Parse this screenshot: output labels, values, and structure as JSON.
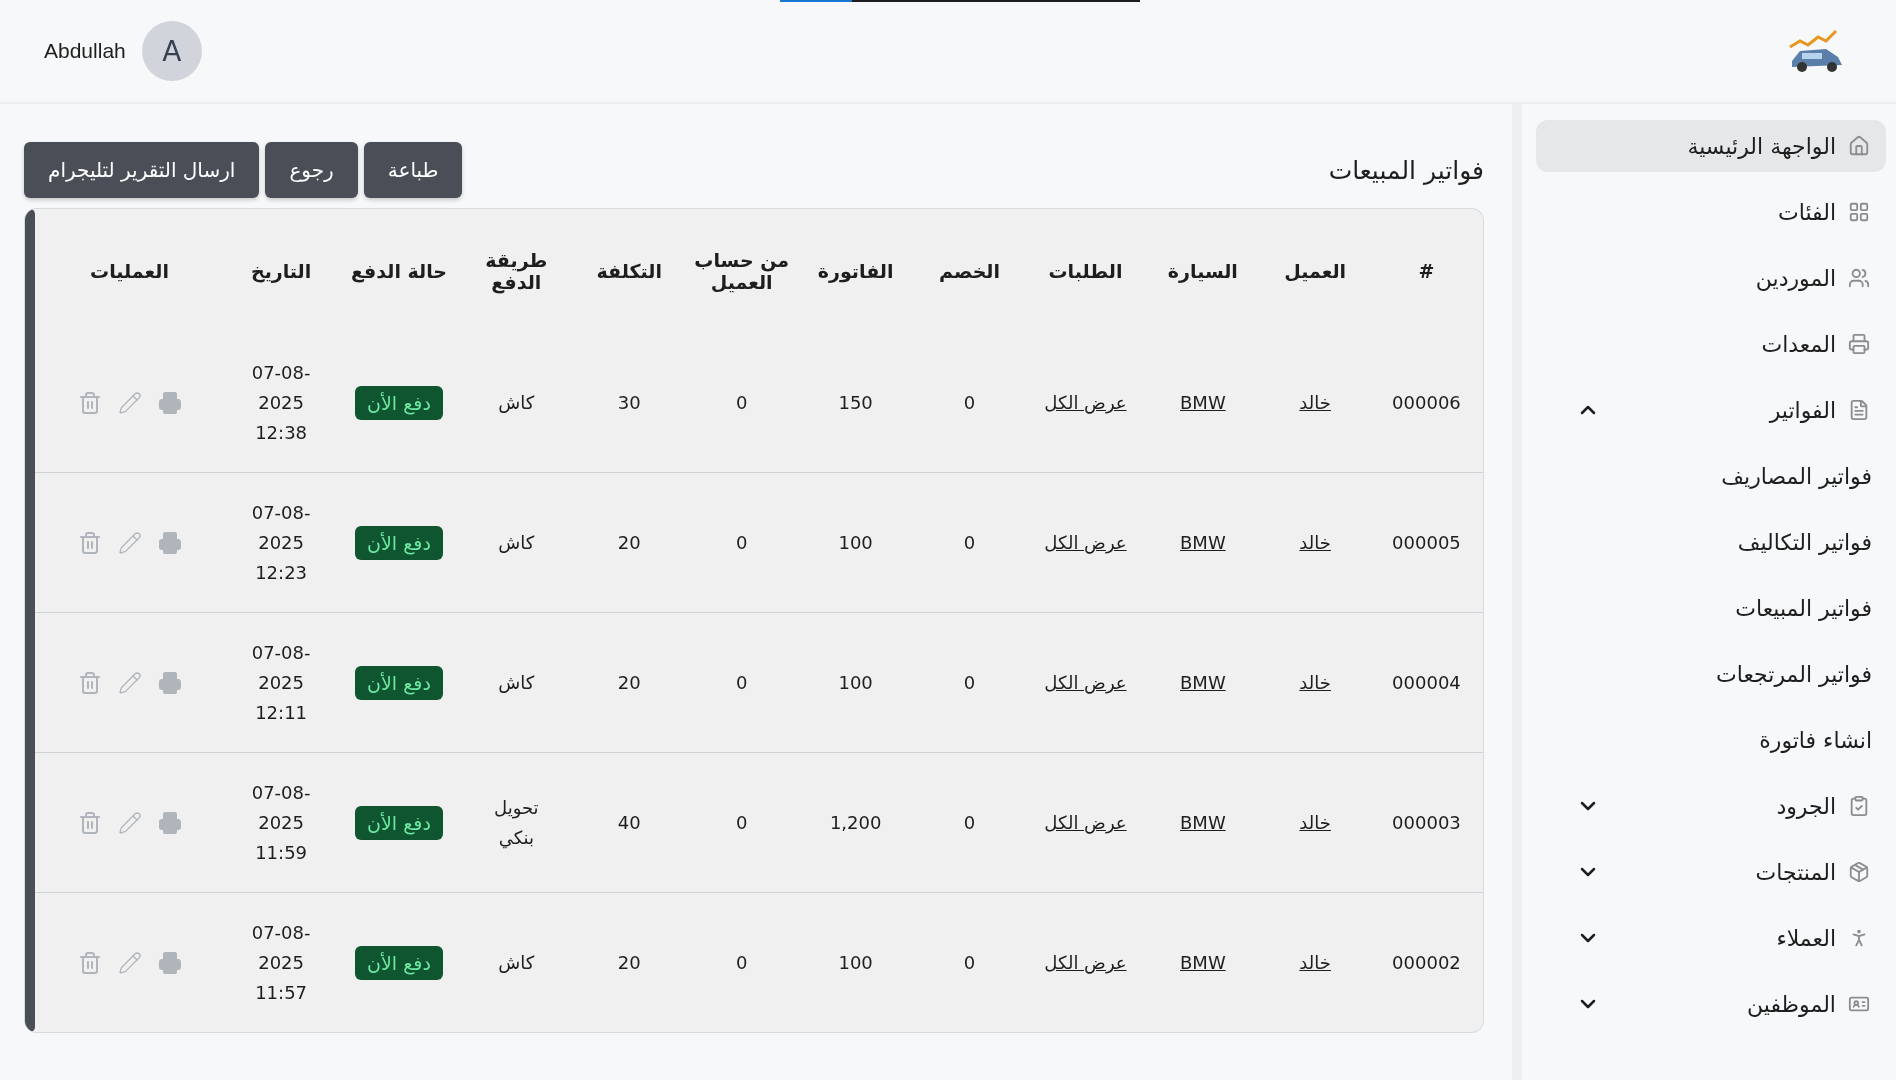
{
  "loading_bar": {
    "level": 0.2
  },
  "user": {
    "name": "Abdullah",
    "initial": "A"
  },
  "page_title": "فواتير المبيعات",
  "actions": [
    {
      "label": "طباعة"
    },
    {
      "label": "رجوع"
    },
    {
      "label": "ارسال التقرير لتليجرام"
    }
  ],
  "table": {
    "columns": [
      "#",
      "العميل",
      "السيارة",
      "الطلبات",
      "الخصم",
      "الفاتورة",
      "من حساب العميل",
      "التكلفة",
      "طريقة الدفع",
      "حالة الدفع",
      "التاريخ",
      "العمليات"
    ],
    "rows": [
      {
        "id": "000006",
        "customer": "خالد",
        "car": "BMW",
        "orders": "عرض الكل",
        "discount": "0",
        "invoice": "150",
        "from_account": "0",
        "cost": "30",
        "payment_method": "كاش",
        "payment_status": "دفع الأن",
        "date": "07-08-2025 12:38"
      },
      {
        "id": "000005",
        "customer": "خالد",
        "car": "BMW",
        "orders": "عرض الكل",
        "discount": "0",
        "invoice": "100",
        "from_account": "0",
        "cost": "20",
        "payment_method": "كاش",
        "payment_status": "دفع الأن",
        "date": "07-08-2025 12:23"
      },
      {
        "id": "000004",
        "customer": "خالد",
        "car": "BMW",
        "orders": "عرض الكل",
        "discount": "0",
        "invoice": "100",
        "from_account": "0",
        "cost": "20",
        "payment_method": "كاش",
        "payment_status": "دفع الأن",
        "date": "07-08-2025 12:11"
      },
      {
        "id": "000003",
        "customer": "خالد",
        "car": "BMW",
        "orders": "عرض الكل",
        "discount": "0",
        "invoice": "1,200",
        "from_account": "0",
        "cost": "40",
        "payment_method": "تحويل بنكي",
        "payment_status": "دفع الأن",
        "date": "07-08-2025 11:59"
      },
      {
        "id": "000002",
        "customer": "خالد",
        "car": "BMW",
        "orders": "عرض الكل",
        "discount": "0",
        "invoice": "100",
        "from_account": "0",
        "cost": "20",
        "payment_method": "كاش",
        "payment_status": "دفع الأن",
        "date": "07-08-2025 11:57"
      }
    ]
  },
  "sidebar": {
    "items": [
      {
        "label": "الواجهة الرئيسية",
        "selected": true
      },
      {
        "label": "الفئات",
        "selected": false
      },
      {
        "label": "الموردين",
        "selected": false
      },
      {
        "label": "المعدات",
        "selected": false
      },
      {
        "label": "الفواتير",
        "selected": false,
        "expanded": true,
        "children": [
          {
            "label": "فواتير المصاريف",
            "selected": false
          },
          {
            "label": "فواتير التكاليف",
            "selected": false
          },
          {
            "label": "فواتير المبيعات",
            "selected": false
          },
          {
            "label": "فواتير المرتجعات",
            "selected": false
          },
          {
            "label": "انشاء فاتورة",
            "selected": false
          }
        ]
      },
      {
        "label": "الجرود",
        "selected": false,
        "expanded": false
      },
      {
        "label": "المنتجات",
        "selected": false,
        "expanded": false
      },
      {
        "label": "العملاء",
        "selected": false,
        "expanded": false
      },
      {
        "label": "الموظفين",
        "selected": false,
        "expanded": false
      }
    ]
  }
}
